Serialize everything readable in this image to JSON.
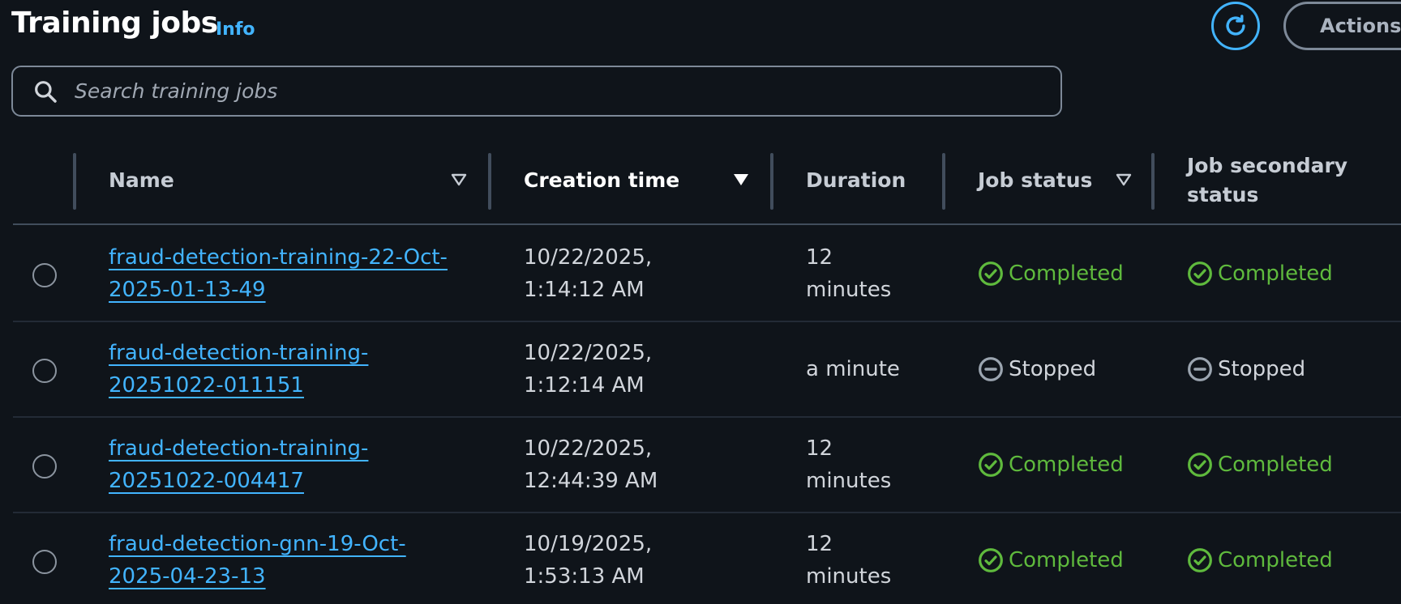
{
  "header": {
    "title": "Training jobs",
    "info_label": "Info",
    "actions_label": "Actions",
    "refresh_icon": "refresh-icon"
  },
  "search": {
    "placeholder": "Search training jobs",
    "value": ""
  },
  "table": {
    "columns": [
      {
        "label": "Name",
        "sort": "sortable"
      },
      {
        "label": "Creation time",
        "sort": "descending"
      },
      {
        "label": "Duration"
      },
      {
        "label": "Job status",
        "sort": "sortable"
      },
      {
        "label_line1": "Job secondary",
        "label_line2": "status"
      }
    ],
    "rows": [
      {
        "name_line1": "fraud-detection-training-22-Oct-",
        "name_line2": "2025-01-13-49",
        "created_line1": "10/22/2025,",
        "created_line2": "1:14:12 AM",
        "duration_line1": "12",
        "duration_line2": "minutes",
        "status": "Completed",
        "secondary_status": "Completed"
      },
      {
        "name_line1": "fraud-detection-training-",
        "name_line2": "20251022-011151",
        "created_line1": "10/22/2025,",
        "created_line2": "1:12:14 AM",
        "duration_line1": "a minute",
        "duration_line2": "",
        "status": "Stopped",
        "secondary_status": "Stopped"
      },
      {
        "name_line1": "fraud-detection-training-",
        "name_line2": "20251022-004417",
        "created_line1": "10/22/2025,",
        "created_line2": "12:44:39 AM",
        "duration_line1": "12",
        "duration_line2": "minutes",
        "status": "Completed",
        "secondary_status": "Completed"
      },
      {
        "name_line1": "fraud-detection-gnn-19-Oct-",
        "name_line2": "2025-04-23-13",
        "created_line1": "10/19/2025,",
        "created_line2": "1:53:13 AM",
        "duration_line1": "12",
        "duration_line2": "minutes",
        "status": "Completed",
        "secondary_status": "Completed"
      }
    ]
  },
  "colors": {
    "background": "#0f141a",
    "link": "#42b4ff",
    "success": "#5fba3d",
    "stopped": "#9ba5b0"
  }
}
